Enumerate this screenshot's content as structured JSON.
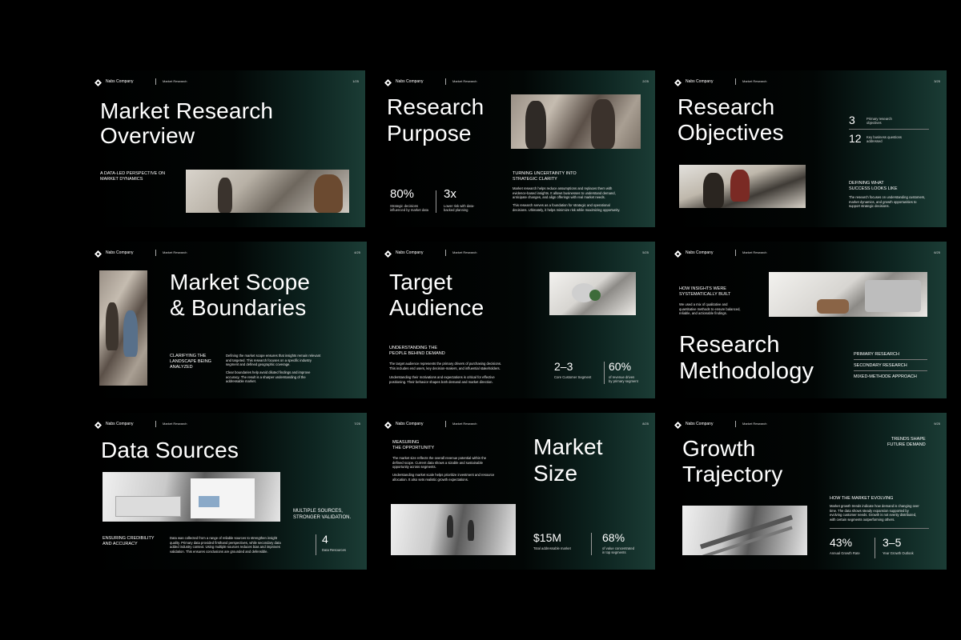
{
  "company": "Nabs Company",
  "tag": "Market Research",
  "slides": [
    {
      "page": "1/25",
      "title_1": "Market Research",
      "title_2": "Overview",
      "sub": "A DATA-LED PERSPECTIVE ON\nMARKET DYNAMICS"
    },
    {
      "page": "2/25",
      "title_1": "Research",
      "title_2": "Purpose",
      "stat1": "80%",
      "stat1_cap": "Strategic decisions\ninfluenced by market data",
      "stat2": "3x",
      "stat2_cap": "Lower risk with data-\nbacked planning",
      "sub": "TURNING UNCERTAINTY INTO\nSTRATEGIC CLARITY",
      "body1": "Market research helps reduce assumptions and replaces them with\nevidence-based insights. It allows businesses to understand demand,\nanticipate changes, and align offerings with real market needs.",
      "body2": "This research serves as a foundation for strategic and operational\ndecisions. Ultimately, it helps minimize risk while maximizing opportunity."
    },
    {
      "page": "3/25",
      "title_1": "Research",
      "title_2": "Objectives",
      "num1": "3",
      "num1_cap": "Primary research\nobjectives",
      "num2": "12",
      "num2_cap": "Key business questions\naddressed",
      "sub": "DEFINING WHAT\nSUCCESS LOOKS LIKE",
      "body": "The research focuses on understanding customers,\nmarket dynamics, and growth opportunities to\nsupport strategic decisions."
    },
    {
      "page": "4/25",
      "title_1": "Market Scope",
      "title_2": "& Boundaries",
      "sub": "CLARIFYING THE\nLANDSCAPE BEING\nANALYZED",
      "body1": "Defining the market scope ensures that insights remain relevant\nand targeted. This research focuses on a specific industry\nsegment and defined geographic coverage.",
      "body2": "Clear boundaries help avoid diluted findings and improve\naccuracy. The result is a sharper understanding of the\naddressable market."
    },
    {
      "page": "5/25",
      "title_1": "Target",
      "title_2": "Audience",
      "sub": "UNDERSTANDING THE\nPEOPLE BEHIND DEMAND",
      "body1": "The target audience represents the primary drivers of purchasing decisions.\nThis includes end users, key decision-makers, and influential stakeholders.",
      "body2": "Understanding their motivations and expectations is critical for effective\npositioning. Their behavior shapes both demand and market direction.",
      "stat1": "2–3",
      "stat1_cap": "Core Customer Segment",
      "stat2": "60%",
      "stat2_cap": "of revenue driven\nby primary segment"
    },
    {
      "page": "6/25",
      "title_1": "Research",
      "title_2": "Methodology",
      "sub": "HOW INSIGHTS WERE\nSYSTEMATICALLY BUILT",
      "body": "We used a mix of qualitative and\nquantitative methods to ensure balanced,\nreliable, and actionable findings.",
      "methods": [
        "PRIMARY RESEARCH",
        "SECONDARY RESEARCH",
        "MIXED-METHODE APPROACH"
      ]
    },
    {
      "page": "7/25",
      "title_1": "Data Sources",
      "sub_right": "MULTIPLE SOURCES,\nSTRONGER VALIDATION.",
      "sub": "ENSURING CREDIBILITY\nAND ACCURACY",
      "body": "Data was collected from a range of reliable sources to strengthen insight\nquality. Primary data provided firsthand perspectives, while secondary data\nadded industry context. Using multiple sources reduces bias and improves\nvalidation. This ensures conclusions are grounded and defensible.",
      "stat": "4",
      "stat_cap": "Data Resources"
    },
    {
      "page": "8/25",
      "title_1": "Market",
      "title_2": "Size",
      "sub": "MEASURING\nTHE OPPORTUNITY",
      "body1": "The market size reflects the overall revenue potential within the\ndefined scope. Current data shows a sizable and sustainable\nopportunity across segments.",
      "body2": "Understanding market scale helps prioritize investment and resource\nallocation. It also sets realistic growth expectations.",
      "stat1": "$15M",
      "stat1_cap": "Total addressable market",
      "stat2": "68%",
      "stat2_cap": "of value concentrated\nin top segments"
    },
    {
      "page": "9/25",
      "title_1": "Growth",
      "title_2": "Trajectory",
      "sub_right": "TRENDS SHAPE\nFUTURE DEMAND",
      "sub": "HOW THE MARKET EVOLVING",
      "body": "Market growth trends indicate how demand is changing over\ntime. The data shows steady expansion supported by\nevolving customer needs. Growth is not evenly distributed,\nwith certain segments outperforming others.",
      "stat1": "43%",
      "stat1_cap": "Annual Growth Rate",
      "stat2": "3–5",
      "stat2_cap": "Year Growth Outlook"
    }
  ]
}
